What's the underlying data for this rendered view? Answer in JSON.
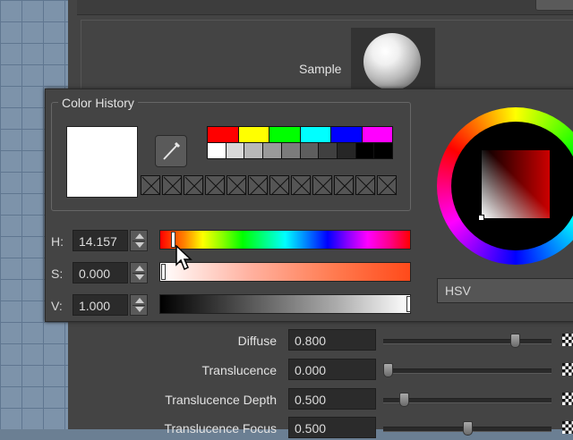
{
  "attribute_editor": {
    "sample_label": "Sample",
    "attributes": [
      {
        "label": "Diffuse",
        "value": "0.800",
        "slider": 0.8
      },
      {
        "label": "Translucence",
        "value": "0.000",
        "slider": 0.0
      },
      {
        "label": "Translucence Depth",
        "value": "0.500",
        "slider": 0.1
      },
      {
        "label": "Translucence Focus",
        "value": "0.500",
        "slider": 0.5
      }
    ]
  },
  "color_chooser": {
    "history_title": "Color History",
    "current_color": "#ffffff",
    "palette_top": [
      "#ff0000",
      "#ffff00",
      "#00ff00",
      "#00ffff",
      "#0000ff",
      "#ff00ff"
    ],
    "palette_bottom": [
      "#ffffff",
      "#d8d8d8",
      "#b8b8b8",
      "#9a9a9a",
      "#7c7c7c",
      "#5e5e5e",
      "#404040",
      "#262626",
      "#000000",
      "#000000"
    ],
    "history_slot_count": 12,
    "h": {
      "label": "H:",
      "value": "14.157",
      "fraction": 0.039
    },
    "s": {
      "label": "S:",
      "value": "0.000",
      "fraction": 0.0
    },
    "v": {
      "label": "V:",
      "value": "1.000",
      "fraction": 1.0
    },
    "mode": "HSV"
  },
  "icons": {
    "eyedropper": "eyedropper-icon",
    "cursor": "arrow-cursor-icon",
    "map_button": "checker-map-icon"
  }
}
